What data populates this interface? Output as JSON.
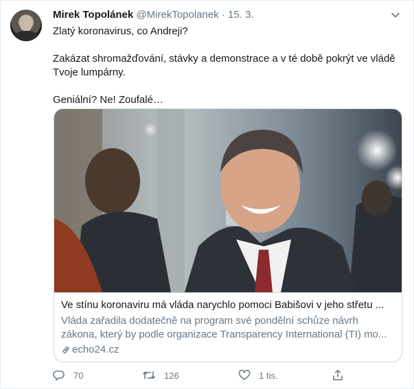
{
  "tweet": {
    "author_name": "Mirek Topolánek",
    "author_handle": "@MirekTopolanek",
    "separator": "·",
    "date": "15. 3.",
    "paragraphs": [
      "Zlatý koronavirus, co Andreji?",
      "Zakázat shromažďování, stávky a demonstrace a v té době pokrýt ve vládě Tvoje lumpárny.",
      "Geniální? Ne! Zoufalé…"
    ]
  },
  "card": {
    "title": "Ve stínu koronaviru má vláda narychlo pomoci Babišovi v jeho střetu ...",
    "description": "Vláda zařadila dodatečně na program své pondělní schůze návrh zákona, který by podle organizace Transparency International (TI) mo...",
    "domain": "echo24.cz"
  },
  "actions": {
    "reply_count": "70",
    "retweet_count": "126",
    "like_count": "1 tis."
  },
  "colors": {
    "text": "#14171a",
    "secondary": "#657786",
    "border": "#ccd6dd"
  },
  "icons": [
    "chevron-down-icon",
    "link-icon",
    "reply-icon",
    "retweet-icon",
    "like-icon",
    "share-icon"
  ]
}
